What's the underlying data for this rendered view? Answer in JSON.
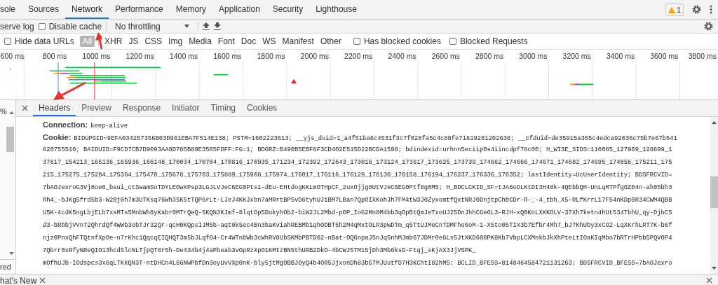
{
  "main_tabs": [
    {
      "label": "sole",
      "selected": false
    },
    {
      "label": "Sources",
      "selected": false
    },
    {
      "label": "Network",
      "selected": true
    },
    {
      "label": "Performance",
      "selected": false
    },
    {
      "label": "Memory",
      "selected": false
    },
    {
      "label": "Application",
      "selected": false
    },
    {
      "label": "Security",
      "selected": false
    },
    {
      "label": "Lighthouse",
      "selected": false
    }
  ],
  "warning_badge": {
    "count": "1"
  },
  "toolbar": {
    "preserve_log": {
      "label": "serve log"
    },
    "disable_cache": {
      "label": "Disable cache",
      "checked": false
    },
    "throttling": {
      "value": "No throttling"
    }
  },
  "filter_bar": {
    "hide_data_urls": {
      "label": "Hide data URLs",
      "checked": false
    },
    "types": [
      {
        "label": "All",
        "selected": true
      },
      {
        "label": "XHR",
        "selected": false
      },
      {
        "label": "JS",
        "selected": false
      },
      {
        "label": "CSS",
        "selected": false
      },
      {
        "label": "Img",
        "selected": false
      },
      {
        "label": "Media",
        "selected": false
      },
      {
        "label": "Font",
        "selected": false
      },
      {
        "label": "Doc",
        "selected": false
      },
      {
        "label": "WS",
        "selected": false
      },
      {
        "label": "Manifest",
        "selected": false
      },
      {
        "label": "Other",
        "selected": false
      }
    ],
    "has_blocked_cookies": {
      "label": "Has blocked cookies",
      "checked": false
    },
    "blocked_requests": {
      "label": "Blocked Requests",
      "checked": false
    }
  },
  "timeline": {
    "ticks": [
      "600 ms",
      "800 ms",
      "1000 ms",
      "1200 ms",
      "1400 ms",
      "1600 ms",
      "1800 ms",
      "2000 ms",
      "2200 ms",
      "2400 ms",
      "2600 ms",
      "2800 ms",
      "3000 ms",
      "3200 ms",
      "3400 ms",
      "3600 ms",
      "3800 ms"
    ]
  },
  "request_list": {
    "column_text": "%",
    "status_text": "red"
  },
  "detail_tabs": [
    {
      "label": "Headers",
      "selected": true
    },
    {
      "label": "Preview",
      "selected": false
    },
    {
      "label": "Response",
      "selected": false
    },
    {
      "label": "Initiator",
      "selected": false
    },
    {
      "label": "Timing",
      "selected": false
    },
    {
      "label": "Cookies",
      "selected": false
    }
  ],
  "headers": [
    {
      "name": "Connection:",
      "lines": [
        "keep-alive"
      ]
    },
    {
      "name": "Cookie:",
      "lines": [
        "BIDUPSID=9EFA034257356B03D981EBA7F514E138; PSTM=1602223613; __yjs_duid=1_a4f51ba6c4531f3c7f028fa5c4c88fe71619281202638; __cfduid=de35915a365c4edca92036c75b7e67b541",
        "620755510; BAIDUID=F9CD7CB7D9093AA8D785B89E3565FDFF:FG=1; BDORZ=B490B5EBF6F3CD402E515D22BCDA1598; bdindexid=urhnn5eciip0s4iincdpf78c00; H_WISE_SIDS=110085_127969_128699_1",
        "37817_154213_165136_165936_166148_170034_170704_170816_170935_171234_172392_172643_173016_173124_173617_173625_173739_174662_174666_174671_174682_174695_174856_175211_175",
        "215_175275_175284_175364_175470_175678_175703_175889_175908_175974_176017_176116_176129_176130_176158_176194_176237_176336_176352; lastIdentity=UcUserIdentity; BDSFRCVID=",
        "7bAOJexroG3Vj8oe6_bsui_ctSwamSoTDYLEOwXPsp3LGJLVJeC6EG0Pts1-dEu-EHtdogKKLmOTHpCF_2uxOjjg8UtVJeC6EG0Ptf8g0M5; H_BDCLCKID_SF=tJA8oDLKtDI3H48k-4QEbbQH-UnLqMTPfgOZ04n-ah05bh3",
        "Rh4_-bJKg5frd5b3-W20j0h7m3UTKsq76Wh35K5tTQP6rLt-LJeJ4KKJxbn7aMRrtBP5vD6tyhUJiBM7LBan7QpOIXKohJh7FM4tW3J0ZyxomtfQxtNRJ0DnjtpChbCDr-R-_-4_tbh_X5-RLfKrrL17F54nKDp0R34CWM4QBB",
        "U5K-4cdK5ngLbjELb7xsMTs5MnbWh8yKabr0MTrQeQ-5KQN3KJmf-8lqtOp5DukyhOb2-biW2JL2Mbd-pOP_IoG2Mn8M4bb3qOpBtQmJeTxoUJ25DnJhhCGe6L3-RJH-xQ0KnLXKKOLV-37Xh7ketn4hUt534TbhU_qy-DjbC5",
        "d3-bRbbjVVn72QhrdQf4WWb3ebTJr32Qr-qcH0KQpsIJM5b-aqt0k5ec4Bn3baKviahREBMb1qhODBT5h2M4qMxtOLR3pWDTm_q5TtUJMeCnTDMFhe6oM-1-X5to05TIX3b7Efbr4Mh7_bJ7KhUby3xCO2-LqXKrhLRT7K-b6f",
        "njz0PnxQhFTQtnfXpOe-n7rKhc1QqcqEIQHQT3m5bJLqfO4-Cr4WTnbWb3cWhRV8UbSKMbPBTD02-nBat-OQ6npaJ5nJq5nhMJmb67JDMr0eGLs5JtXKD600PK8Kb7VbpLCXMnkbJkXhPteLtIOaKIqMbo7bRTrHPbb5PQV0P4",
        "7Qbrr0xRfyNReQIO13hcdSlcNLTjpQT8r5h-De434b4j4aPbeab3vOpRzXpO1KMtzBN5thURB2DkO-4bCWJ5TM15jDh3Mb6ksD-Ftqj_sKjAX3JjV5PK_",
        "mOfhUJb-IOdspcs3x6qLTKkQN3T-ntDHCn4L66NWPbfDn3oyUvVXp0nK-bly5jtMgOBBJ0yQ4b4OR5JjxonDh83bG7MJUutfD7H3KChtI82hM5; BCLID_BFESS=8148464584721131263; BDSFRCVID_BFESS=7bAOJexro"
      ]
    }
  ],
  "drawer": {
    "tab": "hat's New"
  }
}
